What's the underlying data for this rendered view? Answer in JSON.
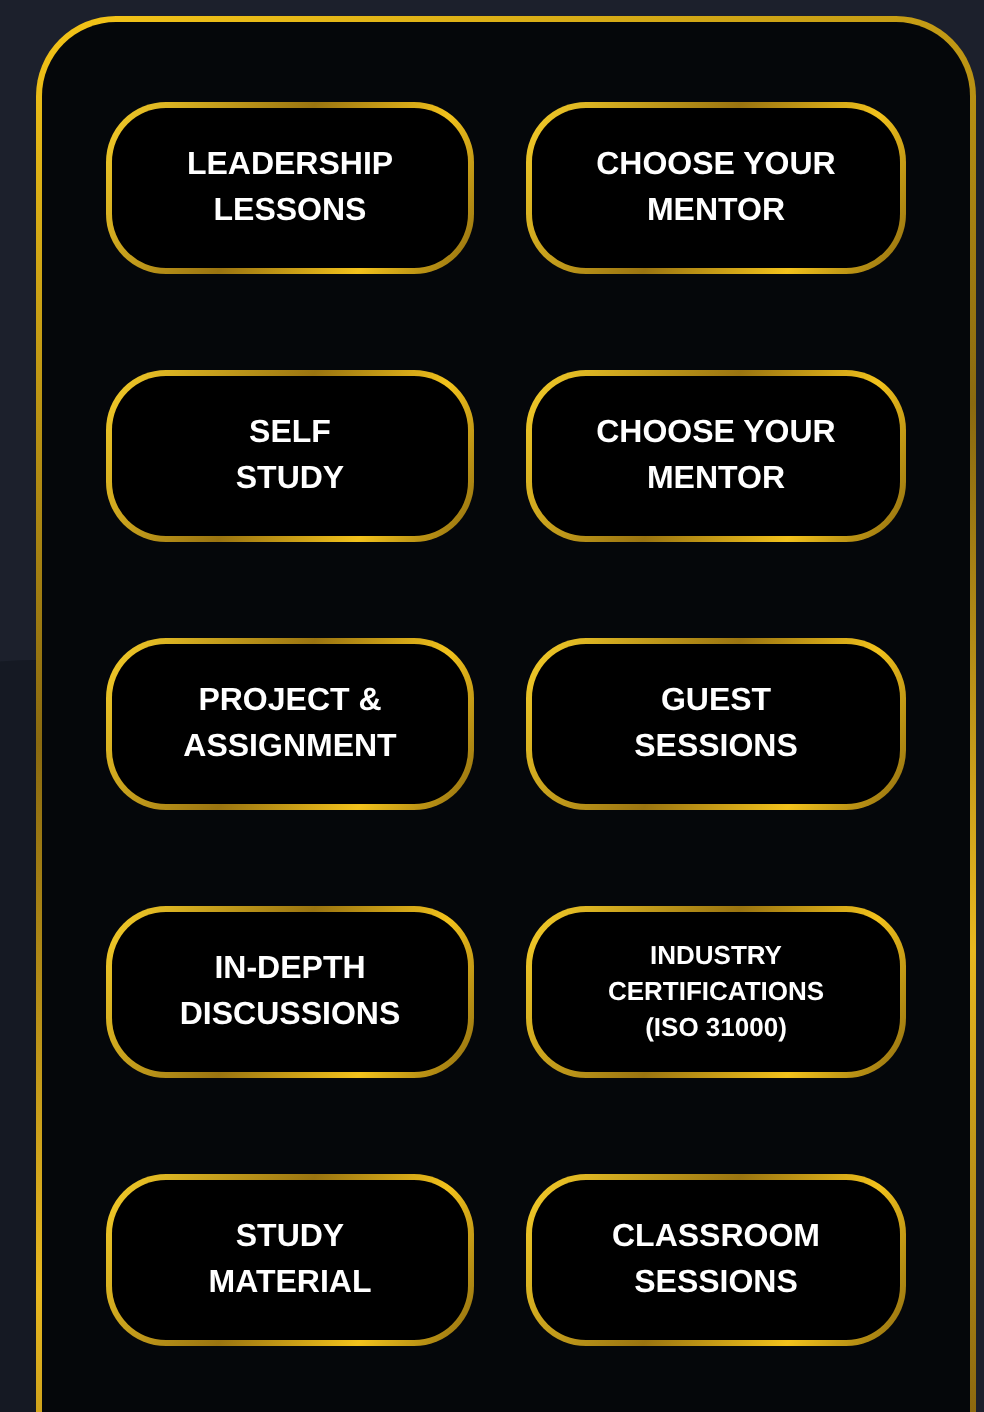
{
  "buttons": [
    {
      "lines": [
        "LEADERSHIP",
        "LESSONS"
      ]
    },
    {
      "lines": [
        "CHOOSE YOUR",
        "MENTOR"
      ]
    },
    {
      "lines": [
        "SELF",
        "STUDY"
      ]
    },
    {
      "lines": [
        "CHOOSE YOUR",
        "MENTOR"
      ]
    },
    {
      "lines": [
        "PROJECT &",
        "ASSIGNMENT"
      ]
    },
    {
      "lines": [
        "GUEST",
        "SESSIONS"
      ]
    },
    {
      "lines": [
        "IN-DEPTH",
        "DISCUSSIONS"
      ]
    },
    {
      "lines": [
        "INDUSTRY",
        "CERTIFICATIONS",
        "(ISO 31000)"
      ]
    },
    {
      "lines": [
        "STUDY",
        "MATERIAL"
      ]
    },
    {
      "lines": [
        "CLASSROOM",
        "SESSIONS"
      ]
    }
  ]
}
